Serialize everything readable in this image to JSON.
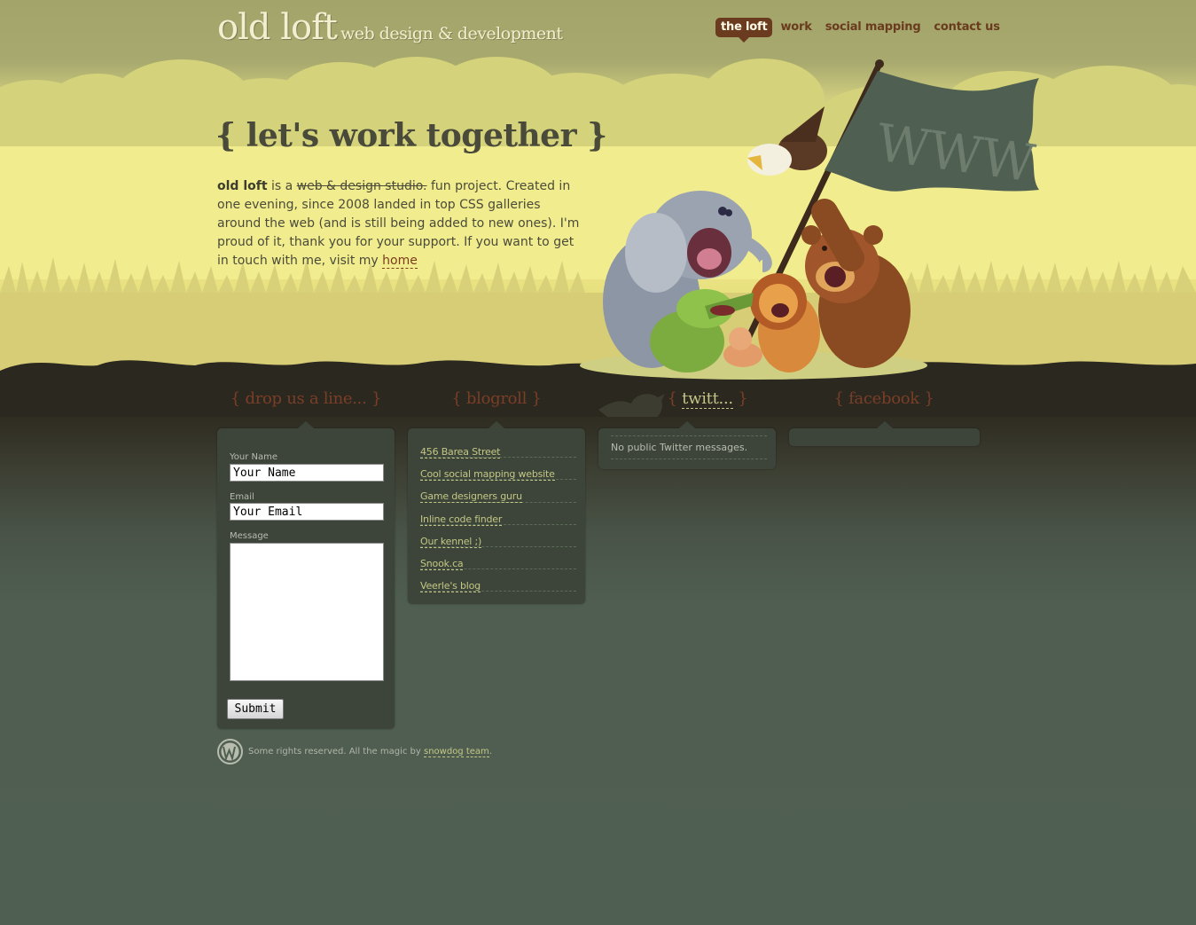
{
  "header": {
    "logo_main": "old loft",
    "logo_sub": "web design & development",
    "nav": [
      {
        "label": "the loft",
        "active": true
      },
      {
        "label": "work"
      },
      {
        "label": "social mapping"
      },
      {
        "label": "contact us"
      }
    ]
  },
  "hero": {
    "headline": "{ let's work together }",
    "flag_text": "WWW",
    "intro_bold": "old loft",
    "intro_is_a": " is a ",
    "intro_strike": "web & design studio.",
    "intro_rest": " fun project. Created in one evening, since 2008 landed in top CSS galleries around the web (and is still being added to new ones). I'm proud of it, thank you for your support. If you want to get in touch with me, visit my ",
    "intro_link": "home"
  },
  "contact": {
    "title": "{ drop us a line... }",
    "name_label": "Your Name",
    "name_value": "Your Name",
    "email_label": "Email",
    "email_value": "Your Email",
    "message_label": "Message",
    "submit_label": "Submit"
  },
  "blogroll": {
    "title": "{ blogroll }",
    "links": [
      "456 Barea Street",
      "Cool social mapping website",
      "Game designers guru",
      "Inline code finder",
      "Our kennel ;)",
      "Snook.ca",
      "Veerle's blog"
    ]
  },
  "twitter": {
    "title_open": "{ ",
    "title_link": "twitt...",
    "title_close": " }",
    "message": "No public Twitter messages."
  },
  "facebook": {
    "title": "{ facebook }"
  },
  "footer": {
    "text_before": "Some rights reserved. All the magic by ",
    "link1": "snowdog",
    "link2": "team",
    "text_after": "."
  },
  "colors": {
    "accent_brown": "#6a3b1f",
    "panel_bg": "#3d453b",
    "link_green": "#c3c784"
  }
}
